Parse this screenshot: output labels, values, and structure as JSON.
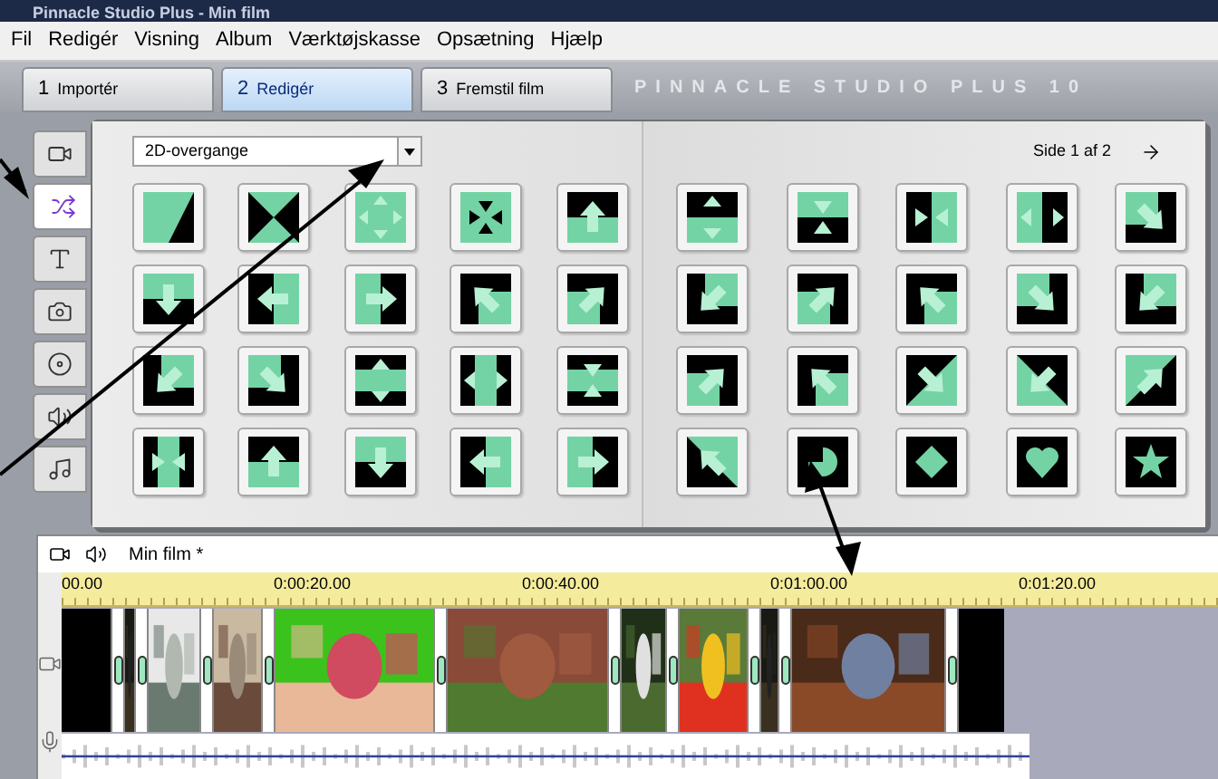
{
  "window": {
    "title": "Pinnacle Studio Plus - Min film"
  },
  "menu": [
    "Fil",
    "Redigér",
    "Visning",
    "Album",
    "Værktøjskasse",
    "Opsætning",
    "Hjælp"
  ],
  "steps": [
    {
      "number": "1",
      "label": "Importér",
      "selected": false
    },
    {
      "number": "2",
      "label": "Redigér",
      "selected": true
    },
    {
      "number": "3",
      "label": "Fremstil film",
      "selected": false
    }
  ],
  "brand": "PINNACLE STUDIO PLUS 10",
  "album_tabs": [
    {
      "selected": false
    },
    {
      "selected": true
    },
    {
      "selected": false
    },
    {
      "selected": false
    },
    {
      "selected": false
    },
    {
      "selected": false
    },
    {
      "selected": false
    }
  ],
  "album": {
    "category": "2D-overgange",
    "page": "Side 1 af 2"
  },
  "timeline": {
    "title": "Min film *",
    "ruler": [
      "00.00",
      "0:00:20.00",
      "0:00:40.00",
      "0:01:00.00",
      "0:01:20.00"
    ]
  }
}
